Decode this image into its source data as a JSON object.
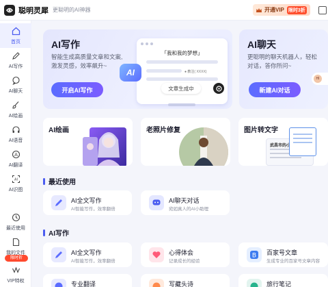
{
  "header": {
    "app_name": "聪明灵犀",
    "slogan": "更聪明的AI神器",
    "vip_label": "开通VIP",
    "vip_discount": "限时3折"
  },
  "sidebar": {
    "items": [
      {
        "label": "首页",
        "icon": "home-icon"
      },
      {
        "label": "AI写作",
        "icon": "pen-icon"
      },
      {
        "label": "AI聊天",
        "icon": "chat-icon"
      },
      {
        "label": "AI绘画",
        "icon": "brush-icon"
      },
      {
        "label": "AI语音",
        "icon": "headphone-icon"
      },
      {
        "label": "AI翻译",
        "icon": "translate-icon"
      },
      {
        "label": "AI识图",
        "icon": "scan-icon"
      },
      {
        "label": "最近使用",
        "icon": "clock-icon"
      },
      {
        "label": "我的文件",
        "icon": "file-icon"
      },
      {
        "label": "VIP特权",
        "icon": "vip-icon"
      }
    ],
    "badge": "限时折"
  },
  "hero": {
    "write": {
      "title": "AI写作",
      "desc_line1": "智能生成高质量文章和文案,",
      "desc_line2": "激发灵感，效率飙升~",
      "button": "开启AI写作",
      "doc_title": "「我和我的梦想」",
      "doc_note": "● 教注( XXXX)",
      "doc_status": "文章生成中",
      "ai_badge": "AI"
    },
    "chat": {
      "title": "AI聊天",
      "desc_line1": "更聪明的聊天机器人，轻松",
      "desc_line2": "对话，答你所问~",
      "button": "新建AI对话",
      "avatar_text": "HI"
    }
  },
  "feature_cards": [
    {
      "title": "AI绘画"
    },
    {
      "title": "老照片修复"
    },
    {
      "title": "图片转文字",
      "doc_title": "武昌市的小雨"
    }
  ],
  "recent": {
    "heading": "最近使用",
    "items": [
      {
        "name": "AI全文写作",
        "desc": "AI智能写作，效率翻倍"
      },
      {
        "name": "AI聊天对话",
        "desc": "宛如真人的AI小助理"
      }
    ]
  },
  "writing": {
    "heading": "AI写作",
    "items": [
      {
        "name": "AI全文写作",
        "desc": "AI智能写作，效率翻倍"
      },
      {
        "name": "心得体会",
        "desc": "记录成长的经验"
      },
      {
        "name": "百家号文章",
        "desc": "生成专业的百家号文章内容"
      },
      {
        "name": "专业翻译"
      },
      {
        "name": "写藏头诗"
      },
      {
        "name": "旅行笔记"
      }
    ]
  },
  "colors": {
    "accent": "#4b5cf0",
    "discount": "#ff4f2e"
  }
}
